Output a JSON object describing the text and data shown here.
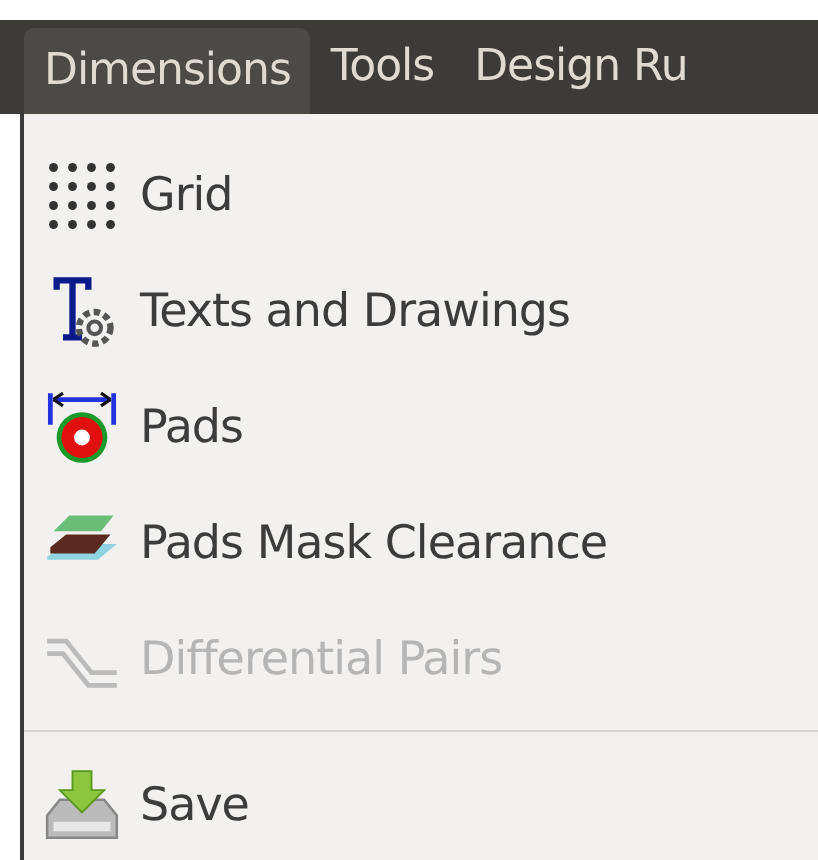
{
  "menubar": [
    {
      "label": "Dimensions",
      "selected": true
    },
    {
      "label": "Tools",
      "selected": false
    },
    {
      "label": "Design Ru",
      "selected": false
    }
  ],
  "menu": {
    "items": [
      {
        "kind": "item",
        "label": "Grid",
        "disabled": false
      },
      {
        "kind": "item",
        "label": "Texts and Drawings",
        "disabled": false
      },
      {
        "kind": "item",
        "label": "Pads",
        "disabled": false
      },
      {
        "kind": "item",
        "label": "Pads Mask Clearance",
        "disabled": false
      },
      {
        "kind": "item",
        "label": "Differential Pairs",
        "disabled": true
      },
      {
        "kind": "separator"
      },
      {
        "kind": "item",
        "label": "Save",
        "disabled": false
      }
    ]
  }
}
